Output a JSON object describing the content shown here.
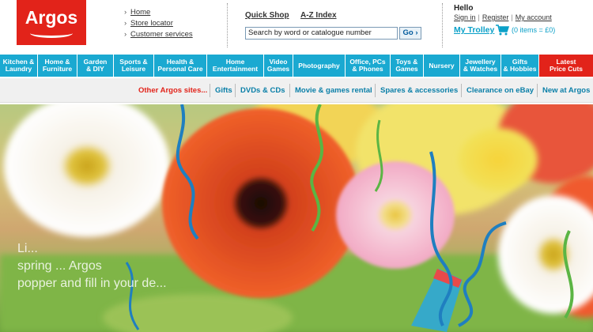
{
  "brand": {
    "logo_text": "Argos",
    "color": "#e2231a"
  },
  "quick_links": [
    {
      "label": "Home"
    },
    {
      "label": "Store locator"
    },
    {
      "label": "Customer services"
    }
  ],
  "search": {
    "quick_shop_label": "Quick Shop",
    "az_index_label": "A-Z Index",
    "value": "Search by word or catalogue number",
    "go_label": "Go",
    "go_arrow": "›"
  },
  "account": {
    "greeting": "Hello",
    "sign_in": "Sign in",
    "register": "Register",
    "my_account": "My account",
    "separator": "|"
  },
  "trolley": {
    "label": "My Trolley",
    "icon": "shopping-cart-icon",
    "summary": "(0 items = £0)"
  },
  "categories": [
    {
      "line1": "Kitchen &",
      "line2": "Laundry"
    },
    {
      "line1": "Home &",
      "line2": "Furniture"
    },
    {
      "line1": "Garden",
      "line2": "& DIY"
    },
    {
      "line1": "Sports &",
      "line2": "Leisure"
    },
    {
      "line1": "Health &",
      "line2": "Personal Care"
    },
    {
      "line1": "Home",
      "line2": "Entertainment"
    },
    {
      "line1": "Video",
      "line2": "Games"
    },
    {
      "line1": "Photography",
      "line2": ""
    },
    {
      "line1": "Office, PCs",
      "line2": "& Phones"
    },
    {
      "line1": "Toys &",
      "line2": "Games"
    },
    {
      "line1": "Nursery",
      "line2": ""
    },
    {
      "line1": "Jewellery",
      "line2": "& Watches"
    },
    {
      "line1": "Gifts",
      "line2": "& Hobbies"
    },
    {
      "line1": "Latest",
      "line2": "Price Cuts"
    }
  ],
  "sub_nav": {
    "other_sites": "Other Argos sites...",
    "links": [
      "Gifts",
      "DVDs & CDs",
      "Movie & games rental",
      "Spares & accessories",
      "Clearance on eBay",
      "New at Argos"
    ]
  },
  "hero": {
    "text_line1": "Li...",
    "text_line2": "spring ... Argos",
    "text_line3": "popper and fill in your de..."
  },
  "colors": {
    "nav_blue": "#1aa9d1",
    "link_blue": "#0a7fa8",
    "sale_red": "#e2231a",
    "subnav_bg": "#f0f0f0"
  }
}
